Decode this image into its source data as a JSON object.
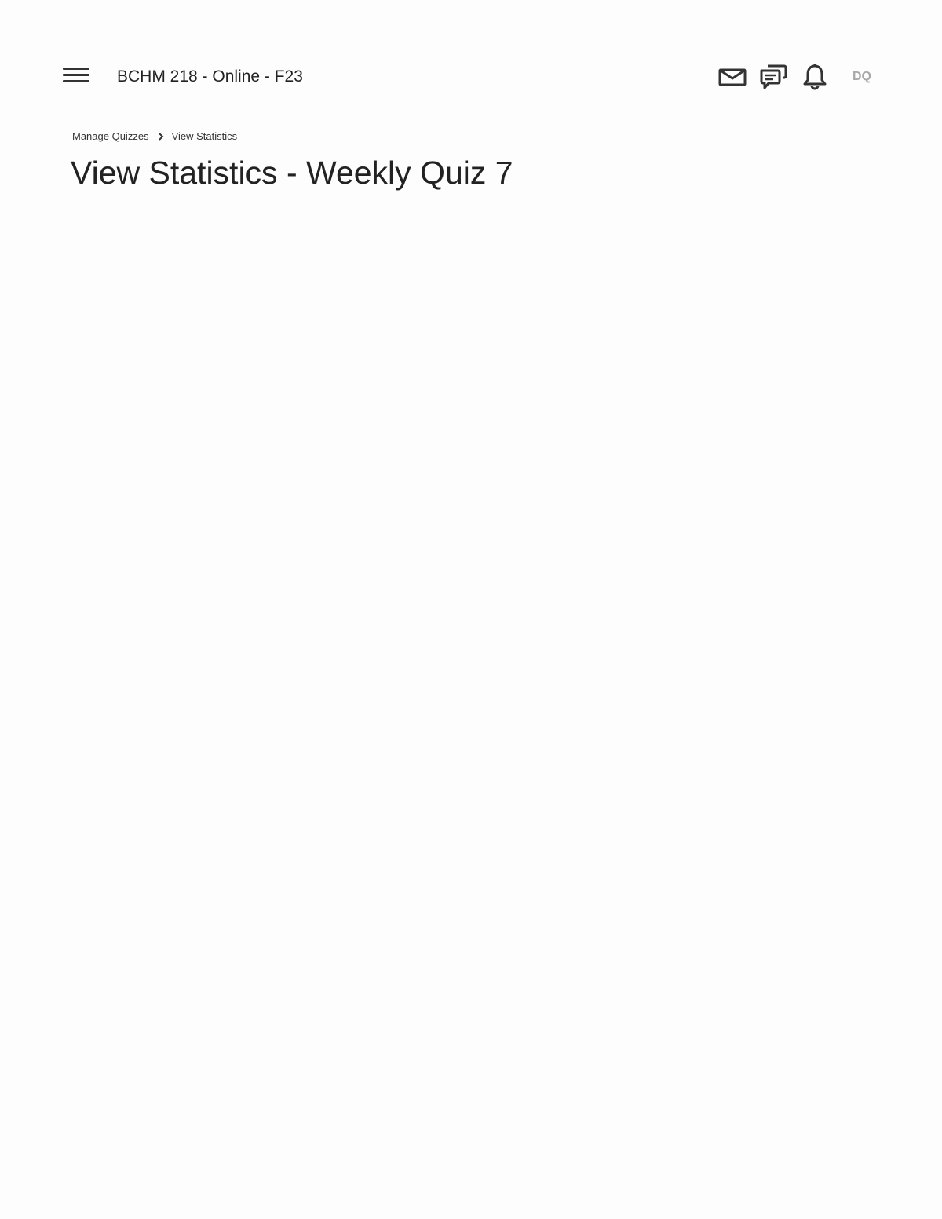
{
  "header": {
    "course_title": "BCHM 218 - Online - F23",
    "avatar_initials": "DQ",
    "icons": [
      "hamburger-menu-icon",
      "mail-icon",
      "chat-icon",
      "bell-icon"
    ]
  },
  "breadcrumb": {
    "items": [
      {
        "label": "Manage Quizzes"
      },
      {
        "label": "View Statistics"
      }
    ],
    "separator_icon": "chevron-right-icon"
  },
  "main": {
    "page_title": "View Statistics - Weekly Quiz 7"
  },
  "colors": {
    "background": "#fdfdfd",
    "text": "#222222",
    "icon": "#333333",
    "avatar_text": "#a8a8a8"
  }
}
